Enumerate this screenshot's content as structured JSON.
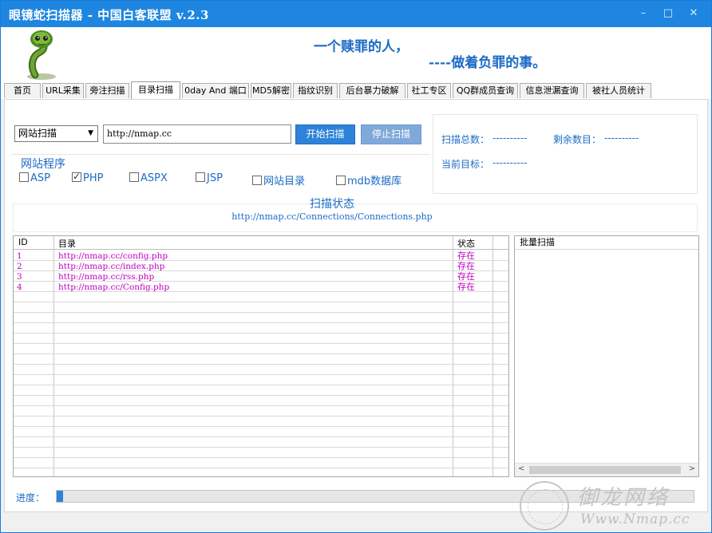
{
  "window": {
    "title": "眼镜蛇扫描器 - 中国白客联盟 v.2.3",
    "minimize": "–",
    "maximize": "□",
    "close": "✕"
  },
  "header": {
    "slogan_line1": "一个赎罪的人，",
    "slogan_line2": "----做着负罪的事。",
    "logo_icon": "cobra-logo"
  },
  "tabs": [
    {
      "label": "首页"
    },
    {
      "label": "URL采集"
    },
    {
      "label": "旁注扫描"
    },
    {
      "label": "目录扫描",
      "active": true
    },
    {
      "label": "0day And 端口"
    },
    {
      "label": "MD5解密"
    },
    {
      "label": "指纹识别"
    },
    {
      "label": "后台暴力破解"
    },
    {
      "label": "社工专区"
    },
    {
      "label": "QQ群成员查询"
    },
    {
      "label": "信息泄漏查询"
    },
    {
      "label": "被社人员统计"
    }
  ],
  "scan": {
    "mode_selected": "网站扫描",
    "url_value": "http://nmap.cc",
    "start_label": "开始扫描",
    "stop_label": "停止扫描"
  },
  "program": {
    "title": "网站程序",
    "options": [
      {
        "label": "ASP",
        "checked": false
      },
      {
        "label": "PHP",
        "checked": true
      },
      {
        "label": "ASPX",
        "checked": false
      },
      {
        "label": "JSP",
        "checked": false
      },
      {
        "label": "网站目录",
        "checked": false
      },
      {
        "label": "mdb数据库",
        "checked": false
      }
    ]
  },
  "stats": {
    "total_label": "扫描总数：",
    "total_value": "----------",
    "remaining_label": "剩余数目：",
    "remaining_value": "----------",
    "target_label": "当前目标：",
    "target_value": "----------"
  },
  "status": {
    "title": "扫描状态",
    "current_url": "http://nmap.cc/Connections/Connections.php"
  },
  "results": {
    "columns": [
      "ID",
      "目录",
      "状态"
    ],
    "rows": [
      {
        "id": "1",
        "path": "http://nmap.cc/config.php",
        "state": "存在"
      },
      {
        "id": "2",
        "path": "http://nmap.cc/index.php",
        "state": "存在"
      },
      {
        "id": "3",
        "path": "http://nmap.cc/rss.php",
        "state": "存在"
      },
      {
        "id": "4",
        "path": "http://nmap.cc/Config.php",
        "state": "存在"
      }
    ],
    "row_color": "#c000c0"
  },
  "batch": {
    "title": "批量扫描",
    "scroll_left": "<",
    "scroll_right": ">"
  },
  "progress": {
    "label": "进度：",
    "percent": 1
  },
  "watermark": {
    "name": "御龙网络",
    "url": "Www.Nmap.cc"
  },
  "colors": {
    "titlebar": "#1e86e0",
    "accent": "#1c6bc6",
    "button": "#2e83d9"
  }
}
